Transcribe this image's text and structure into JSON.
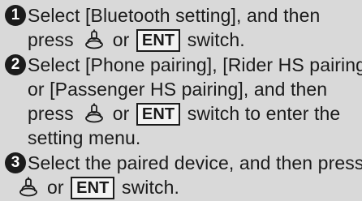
{
  "steps": [
    {
      "number": "1",
      "line1": "Select [Bluetooth setting], and then",
      "line2_pre": "press",
      "or": "or",
      "ent": "ENT",
      "line2_post": "switch."
    },
    {
      "number": "2",
      "line1": "Select [Phone pairing], [Rider HS pairing]",
      "line2": "or [Passenger HS pairing], and then",
      "line3_pre": "press",
      "or": "or",
      "ent": "ENT",
      "line3_post": "switch to enter the",
      "line4": "setting menu."
    },
    {
      "number": "3",
      "line1": "Select the paired device, and then press",
      "or": "or",
      "ent": "ENT",
      "line2_post": "switch."
    }
  ],
  "icons": {
    "push_switch": "push-switch-icon"
  }
}
